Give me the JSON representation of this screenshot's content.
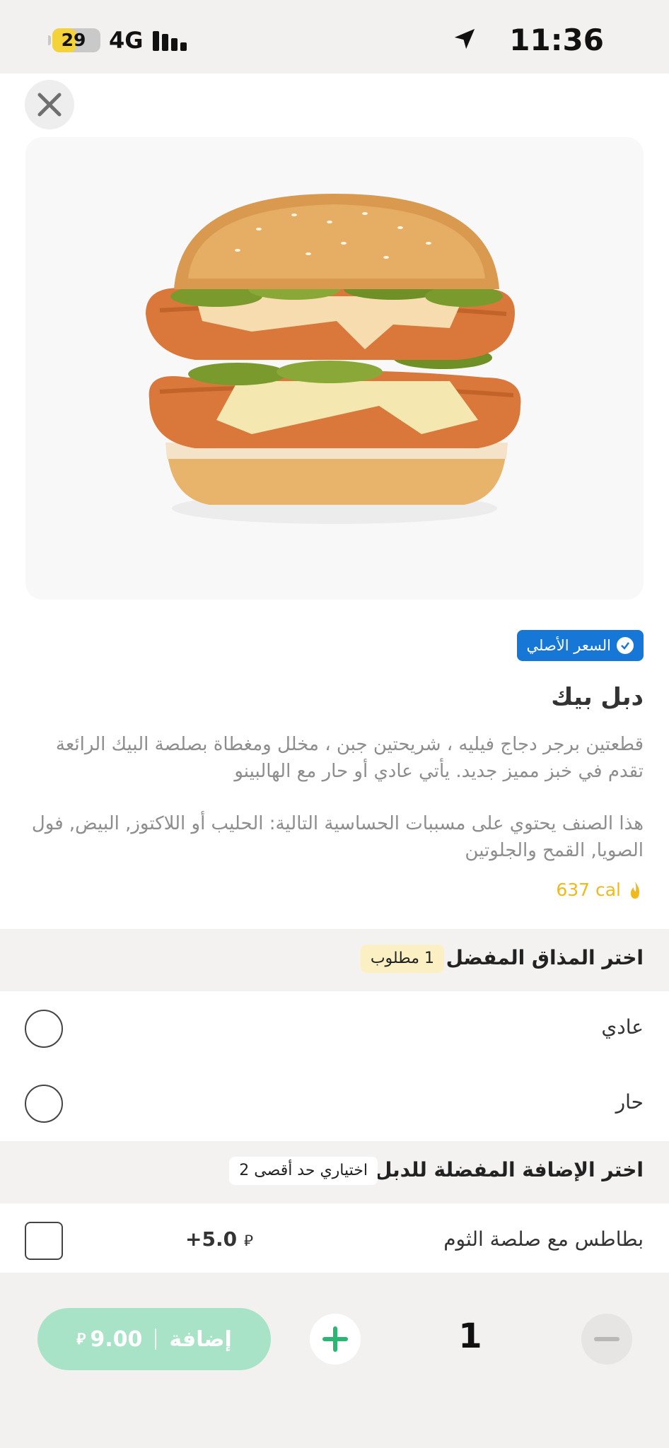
{
  "status_bar": {
    "battery": "29",
    "battery_level": 0.5,
    "network": "4G",
    "time": "11:36"
  },
  "product": {
    "badge": "السعر الأصلي",
    "name": "دبل بيك",
    "description": "قطعتين برجر  دجاج فيليه ، شريحتين جبن ، مخلل ومغطاة بصلصة البيك الرائعة تقدم في خبز مميز جديد. يأتي عادي أو حار مع الهالبينو",
    "allergens": "هذا الصنف يحتوي على مسببات الحساسية التالية: الحليب أو اللاكتوز, البيض, فول الصويا, القمح والجلوتين",
    "calories": "637 cal"
  },
  "sections": [
    {
      "title": "اختر المذاق المفضل",
      "tag": "1 مطلوب",
      "options": [
        {
          "label": "عادي"
        },
        {
          "label": "حار"
        }
      ]
    },
    {
      "title": "اختر الإضافة المفضلة للدبل",
      "tag": "اختياري حد أقصى 2",
      "options": [
        {
          "label": "بطاطس مع صلصة الثوم",
          "price": "+5.0"
        }
      ]
    }
  ],
  "bottom_bar": {
    "add_label": "إضافة",
    "price": "9.00",
    "quantity": "1"
  },
  "colors": {
    "badge": "#1677d6",
    "accent_green": "#2bb673",
    "add_button": "#a8e3c8",
    "calories": "#f0b91c"
  }
}
